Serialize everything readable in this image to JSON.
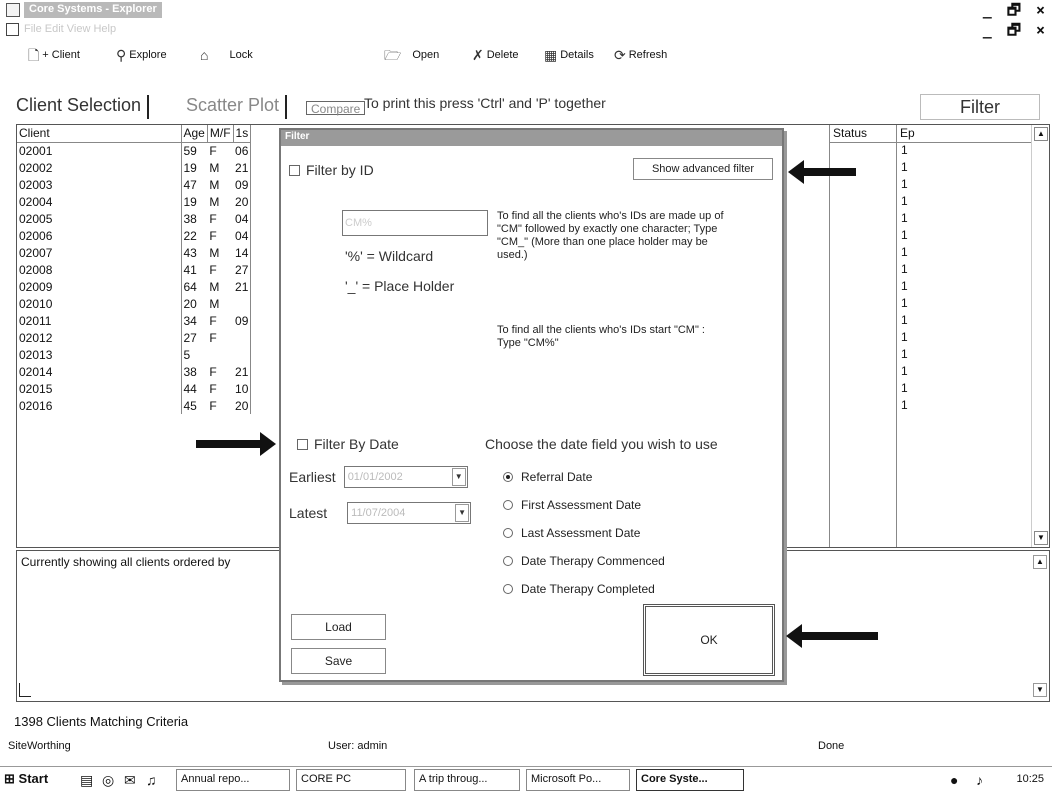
{
  "window": {
    "title": "Core Systems - Explorer",
    "menu_text": "File  Edit  View  Help",
    "controls": "_ 🗗 ×"
  },
  "toolbar": {
    "client_label": "+ Client",
    "explore_label": "Explore",
    "lock_label": "Lock",
    "open_label": "Open",
    "delete_label": "Delete",
    "details_label": "Details",
    "refresh_label": "Refresh"
  },
  "tabs": {
    "client_selection": "Client Selection",
    "scatter_plot": "Scatter Plot",
    "compare": "Compare",
    "print_hint": "To print this press 'Ctrl' and 'P' together"
  },
  "filter_button": "Filter",
  "grid": {
    "headers": [
      "Client",
      "Age",
      "M/F",
      "1s"
    ],
    "status_header": "Status",
    "ep_header": "Ep",
    "rows": [
      [
        "02001",
        "59",
        "F",
        "06"
      ],
      [
        "02002",
        "19",
        "M",
        "21"
      ],
      [
        "02003",
        "47",
        "M",
        "09"
      ],
      [
        "02004",
        "19",
        "M",
        "20"
      ],
      [
        "02005",
        "38",
        "F",
        "04"
      ],
      [
        "02006",
        "22",
        "F",
        "04"
      ],
      [
        "02007",
        "43",
        "M",
        "14"
      ],
      [
        "02008",
        "41",
        "F",
        "27"
      ],
      [
        "02009",
        "64",
        "M",
        "21"
      ],
      [
        "02010",
        "20",
        "M",
        ""
      ],
      [
        "02011",
        "34",
        "F",
        "09"
      ],
      [
        "02012",
        "27",
        "F",
        ""
      ],
      [
        "02013",
        "5",
        "",
        ""
      ],
      [
        "02014",
        "38",
        "F",
        "21"
      ],
      [
        "02015",
        "44",
        "F",
        "10"
      ],
      [
        "02016",
        "45",
        "F",
        "20"
      ]
    ],
    "ep_values": [
      "1",
      "1",
      "1",
      "1",
      "1",
      "1",
      "1",
      "1",
      "1",
      "1",
      "1",
      "1",
      "1",
      "1",
      "1",
      "1"
    ]
  },
  "description": "Currently showing all clients ordered by",
  "matching": "1398 Clients Matching Criteria",
  "statusbar": {
    "left": "SiteWorthing",
    "user": "User: admin",
    "state": "Done"
  },
  "taskbar": {
    "start": "Start",
    "items": [
      "Annual repo...",
      "CORE PC",
      "A trip throug...",
      "Microsoft Po...",
      "Core Syste..."
    ],
    "clock": "10:25"
  },
  "dialog": {
    "title": "Filter",
    "filter_by_id": "Filter by ID",
    "show_advanced": "Show advanced filter",
    "id_placeholder": "CM%",
    "wildcard": "'%' = Wildcard",
    "placeholder_hint": "'_' = Place Holder",
    "help1": "To find all the clients who's IDs are made up of \"CM\" followed by exactly one character; Type \"CM_\" (More than one place holder may be used.)",
    "help2": "To find all the clients who's IDs start \"CM\" : Type \"CM%\"",
    "filter_by_date": "Filter By Date",
    "choose_date": "Choose the date field you wish to use",
    "earliest": "Earliest",
    "latest": "Latest",
    "earliest_value": "01/01/2002",
    "latest_value": "11/07/2004",
    "date_options": [
      "Referral Date",
      "First Assessment Date",
      "Last Assessment Date",
      "Date Therapy Commenced",
      "Date Therapy Completed"
    ],
    "selected_option": "Referral Date",
    "load": "Load",
    "save": "Save",
    "ok": "OK"
  }
}
